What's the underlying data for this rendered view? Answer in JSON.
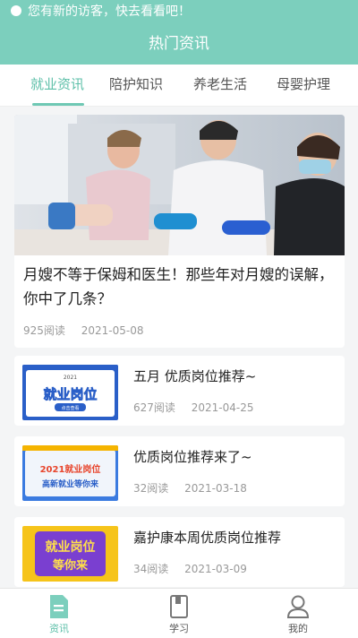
{
  "notice": {
    "text": "您有新的访客，快去看看吧！"
  },
  "header": {
    "title": "热门资讯"
  },
  "tabs": [
    {
      "label": "就业资讯",
      "active": true
    },
    {
      "label": "陪护知识",
      "active": false
    },
    {
      "label": "养老生活",
      "active": false
    },
    {
      "label": "母婴护理",
      "active": false
    }
  ],
  "featured": {
    "title": "月嫂不等于保姆和医生！那些年对月嫂的误解，你中了几条？",
    "reads": "925阅读",
    "date": "2021-05-08"
  },
  "articles": [
    {
      "title": "五月 优质岗位推荐~",
      "reads": "627阅读",
      "date": "2021-04-25",
      "thumb": {
        "tag": "2021",
        "main": "就业岗位",
        "sub": "点击查看"
      }
    },
    {
      "title": "优质岗位推荐来了~",
      "reads": "32阅读",
      "date": "2021-03-18",
      "thumb": {
        "line1": "2021就业岗位",
        "line2": "高新就业等你来"
      }
    },
    {
      "title": "嘉护康本周优质岗位推荐",
      "reads": "34阅读",
      "date": "2021-03-09",
      "thumb": {
        "line1": "就业岗位",
        "line2": "等你来"
      }
    }
  ],
  "nav": [
    {
      "label": "资讯",
      "icon": "news-doc-icon",
      "active": true
    },
    {
      "label": "学习",
      "icon": "book-icon",
      "active": false
    },
    {
      "label": "我的",
      "icon": "user-icon",
      "active": false
    }
  ],
  "colors": {
    "accent": "#7ccfbd",
    "active_text": "#5cbfa8"
  }
}
